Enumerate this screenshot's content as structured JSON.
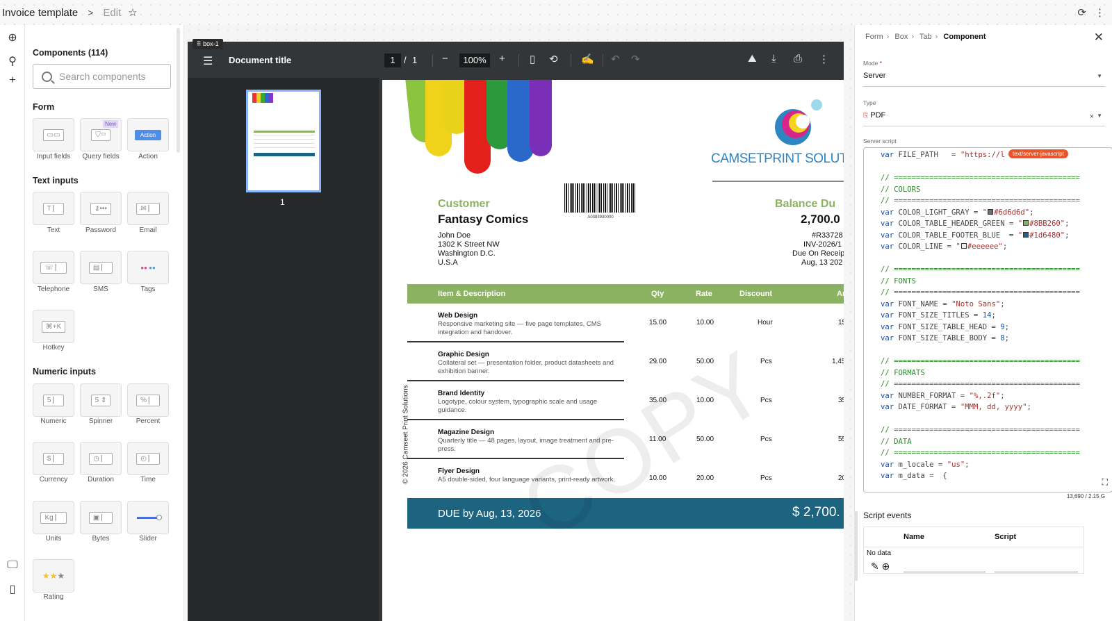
{
  "topbar": {
    "title": "Invoice template",
    "separator": ">",
    "edit_label": "Edit"
  },
  "components": {
    "heading": "Components (114)",
    "search_placeholder": "Search components",
    "sections": {
      "form": {
        "title": "Form",
        "items": [
          "Input fields",
          "Query fields",
          "Action"
        ],
        "new_badge": "New",
        "action_badge": "Action"
      },
      "text": {
        "title": "Text inputs",
        "items": [
          "Text",
          "Password",
          "Email",
          "Telephone",
          "SMS",
          "Tags",
          "Hotkey"
        ]
      },
      "numeric": {
        "title": "Numeric inputs",
        "items": [
          "Numeric",
          "Spinner",
          "Percent",
          "Currency",
          "Duration",
          "Time",
          "Units",
          "Bytes",
          "Slider",
          "Rating"
        ]
      }
    }
  },
  "viewer": {
    "box_tag": "box-1",
    "doc_title": "Document title",
    "page": "1",
    "slash": "/",
    "total": "1",
    "zoom": "100%",
    "thumb_num": "1"
  },
  "invoice": {
    "company": "CAMSETPRINT SOLUTI",
    "barcode_number": "A0383930000",
    "customer_label": "Customer",
    "customer_name": "Fantasy Comics",
    "address": [
      "John Doe",
      "1302 K Street NW",
      "Washington D.C.",
      "U.S.A"
    ],
    "balance_label": "Balance Du",
    "balance_value": "2,700.0",
    "right_info": [
      "#R33728",
      "INV-2026/1",
      "Due On Receip",
      "Aug, 13 202"
    ],
    "headers": {
      "item": "Item & Description",
      "qty": "Qty",
      "rate": "Rate",
      "discount": "Discount",
      "amount": "Amo"
    },
    "rows": [
      {
        "name": "Web Design",
        "desc": "Responsive marketing site — five page templates, CMS integration and handover.",
        "qty": "15.00",
        "rate": "10.00",
        "discount": "Hour",
        "amount": "15"
      },
      {
        "name": "Graphic Design",
        "desc": "Collateral set — presentation folder, product datasheets and exhibition banner.",
        "qty": "29.00",
        "rate": "50.00",
        "discount": "Pcs",
        "amount": "1,45"
      },
      {
        "name": "Brand Identity",
        "desc": "Logotype, colour system, typographic scale and usage guidance.",
        "qty": "35.00",
        "rate": "10.00",
        "discount": "Pcs",
        "amount": "35"
      },
      {
        "name": "Magazine Design",
        "desc": "Quarterly title — 48 pages, layout, image treatment and pre-press.",
        "qty": "11.00",
        "rate": "50.00",
        "discount": "Pcs",
        "amount": "55"
      },
      {
        "name": "Flyer Design",
        "desc": "A5 double-sided, four language variants, print-ready artwork.",
        "qty": "10.00",
        "rate": "20.00",
        "discount": "Pcs",
        "amount": "20"
      }
    ],
    "due_text": "DUE by Aug, 13, 2026",
    "due_amount": "$ 2,700.",
    "vertical_text": "© 2026 Camseet Print Solutions",
    "watermark": "COPY",
    "colors": {
      "green": "#8bb260",
      "blue": "#1d6480"
    }
  },
  "rightpanel": {
    "breadcrumb": [
      "Form",
      "Box",
      "Tab",
      "Component"
    ],
    "mode_label": "Mode",
    "mode_required": "*",
    "mode_value": "Server",
    "type_label": "Type",
    "type_value": "PDF",
    "script_label": "Server script",
    "script_badge": "text/server-javascript",
    "code": {
      "l1_kw": "var",
      "l1_rest": " FILE_PATH   = ",
      "l1_str": "\"https://l",
      "div": "// ==========================================",
      "colors": "// COLORS",
      "c1_name": " COLOR_LIGHT_GRAY = ",
      "c1_val": "#6d6d6d",
      "c2_name": " COLOR_TABLE_HEADER_GREEN = ",
      "c2_val": "#8BB260",
      "c3_name": " COLOR_TABLE_FOOTER_BLUE  = ",
      "c3_val": "#1d6480",
      "c4_name": " COLOR_LINE = ",
      "c4_val": "#eeeeee",
      "fonts": "// FONTS",
      "f1_name": " FONT_NAME = ",
      "f1_val": "\"Noto Sans\"",
      "f2_name": " FONT_SIZE_TITLES = ",
      "f2_val": "14",
      "f3_name": " FONT_SIZE_TABLE_HEAD = ",
      "f3_val": "9",
      "f4_name": " FONT_SIZE_TABLE_BODY = ",
      "f4_val": "8",
      "formats": "// FORMATS",
      "n1_name": " NUMBER_FORMAT = ",
      "n1_val": "\"%,.2f\"",
      "n2_name": " DATE_FORMAT = ",
      "n2_val": "\"MMM, dd, yyyy\"",
      "data": "// DATA",
      "d1_name": " m_locale = ",
      "d1_val": "\"us\"",
      "d2_name": " m_data = ",
      "d2_val": "{"
    },
    "count": "13,690 / 2.15 G",
    "events_title": "Script events",
    "col_name": "Name",
    "col_script": "Script",
    "no_data": "No data"
  }
}
